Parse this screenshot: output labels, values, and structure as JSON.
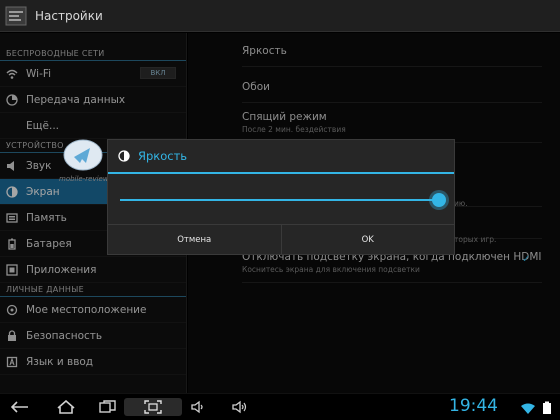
{
  "app": {
    "title": "Настройки"
  },
  "sidebar": {
    "sections": [
      {
        "label": "БЕСПРОВОДНЫЕ СЕТИ"
      },
      {
        "label": "УСТРОЙСТВО"
      },
      {
        "label": "ЛИЧНЫЕ ДАННЫЕ"
      }
    ],
    "items": [
      {
        "label": "Wi-Fi",
        "toggle": "ВКЛ"
      },
      {
        "label": "Передача данных"
      },
      {
        "label": "Ещё..."
      },
      {
        "label": "Звук"
      },
      {
        "label": "Экран"
      },
      {
        "label": "Память"
      },
      {
        "label": "Батарея"
      },
      {
        "label": "Приложения"
      },
      {
        "label": "Мое местоположение"
      },
      {
        "label": "Безопасность"
      },
      {
        "label": "Язык и ввод"
      }
    ]
  },
  "main": {
    "prefs": [
      {
        "title": "Яркость",
        "summary": ""
      },
      {
        "title": "Обои",
        "summary": ""
      },
      {
        "title": "Спящий режим",
        "summary": "После 2 мин. бездействия"
      },
      {
        "title": "Отключать подсветку экрана, когда подключен HDMI",
        "summary": "Коснитесь экрана для включения подсветки"
      }
    ],
    "partials": [
      "ию.",
      "торых игр."
    ]
  },
  "dialog": {
    "title": "Яркость",
    "brightness": 1.0,
    "cancel_label": "Отмена",
    "ok_label": "OK"
  },
  "watermark": {
    "text": "mobile-review.com"
  },
  "status": {
    "time": "19:44"
  },
  "colors": {
    "accent": "#33b5e5",
    "selected": "#1c6f9e"
  }
}
